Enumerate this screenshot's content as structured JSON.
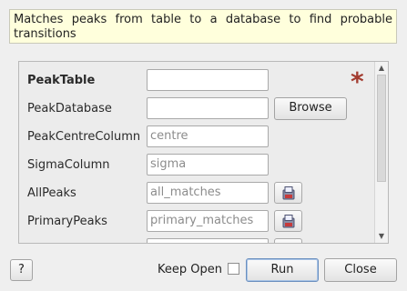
{
  "description": "Matches peaks from table to a database to find probable transitions",
  "properties": [
    {
      "label": "PeakTable",
      "value": "",
      "placeholder": "",
      "bold": true,
      "button": "",
      "mandatory": true
    },
    {
      "label": "PeakDatabase",
      "value": "",
      "placeholder": "",
      "bold": false,
      "button": "Browse"
    },
    {
      "label": "PeakCentreColumn",
      "value": "",
      "placeholder": "centre",
      "bold": false,
      "button": ""
    },
    {
      "label": "SigmaColumn",
      "value": "",
      "placeholder": "sigma",
      "bold": false,
      "button": ""
    },
    {
      "label": "AllPeaks",
      "value": "",
      "placeholder": "all_matches",
      "bold": false,
      "button": "save-icon"
    },
    {
      "label": "PrimaryPeaks",
      "value": "",
      "placeholder": "primary_matches",
      "bold": false,
      "button": "save-icon"
    }
  ],
  "mandatory_marker": "*",
  "footer": {
    "help_label": "?",
    "keep_open_label": "Keep Open",
    "keep_open_checked": false,
    "run_label": "Run",
    "close_label": "Close"
  },
  "colors": {
    "description_bg": "#ffffdc",
    "mandatory": "#a33c30"
  }
}
